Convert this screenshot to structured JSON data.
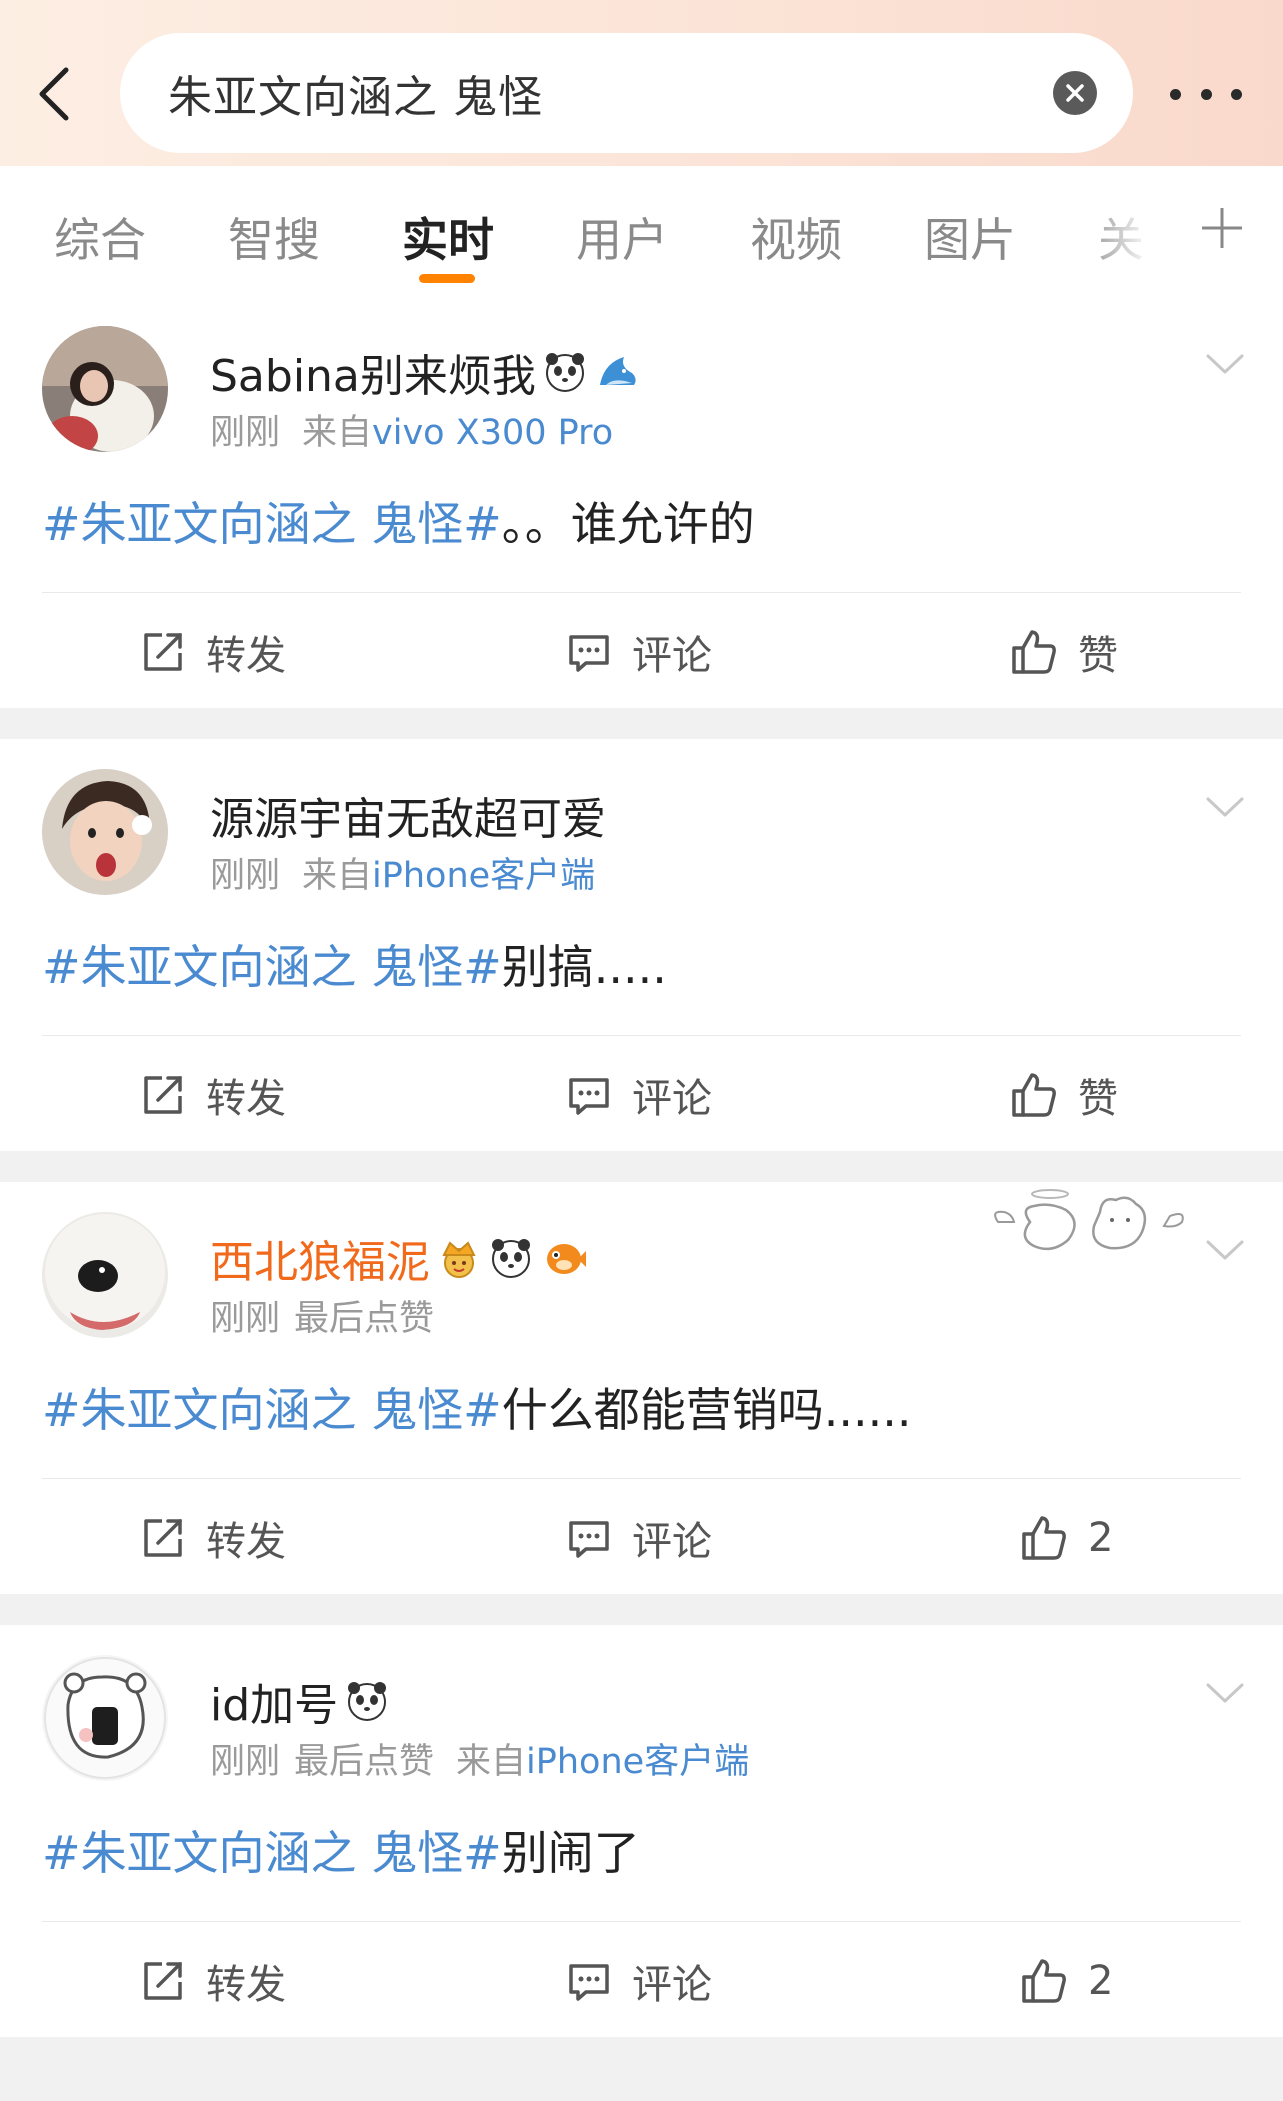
{
  "search": {
    "query": "朱亚文向涵之 鬼怪"
  },
  "tabs": [
    {
      "label": "综合"
    },
    {
      "label": "智搜"
    },
    {
      "label": "实时",
      "active": true
    },
    {
      "label": "用户"
    },
    {
      "label": "视频"
    },
    {
      "label": "图片"
    },
    {
      "label": "关"
    }
  ],
  "actions": {
    "repost_label": "转发",
    "comment_label": "评论",
    "like_label": "赞"
  },
  "posts": [
    {
      "username": "Sabina别来烦我",
      "time": "刚刚",
      "status": "",
      "source_prefix": "来自",
      "source": "vivo X300 Pro",
      "hashtag": "#朱亚文向涵之 鬼怪#",
      "body": "。。谁允许的",
      "likes": "赞",
      "badges": [
        "panda-badge-icon",
        "shark-badge-icon"
      ]
    },
    {
      "username": "源源宇宙无敌超可爱",
      "time": "刚刚",
      "status": "",
      "source_prefix": "来自",
      "source": "iPhone客户端",
      "hashtag": "#朱亚文向涵之 鬼怪#",
      "body": "别搞.....",
      "likes": "赞",
      "badges": []
    },
    {
      "username": "西北狼福泥",
      "time": "刚刚",
      "status": "最后点赞",
      "source_prefix": "",
      "source": "",
      "hashtag": "#朱亚文向涵之 鬼怪#",
      "body": "什么都能营销吗......",
      "likes": "2",
      "badges": [
        "crown-badge-icon",
        "panda-badge-icon",
        "pufferfish-badge-icon"
      ]
    },
    {
      "username": "id加号",
      "time": "刚刚",
      "status": "最后点赞",
      "source_prefix": "来自",
      "source": "iPhone客户端",
      "hashtag": "#朱亚文向涵之 鬼怪#",
      "body": "别闹了",
      "likes": "2",
      "badges": [
        "panda-badge-icon"
      ]
    }
  ],
  "colors": {
    "accent": "#ff8200",
    "link": "#4a8ad0",
    "vip_name": "#f16a1c"
  }
}
